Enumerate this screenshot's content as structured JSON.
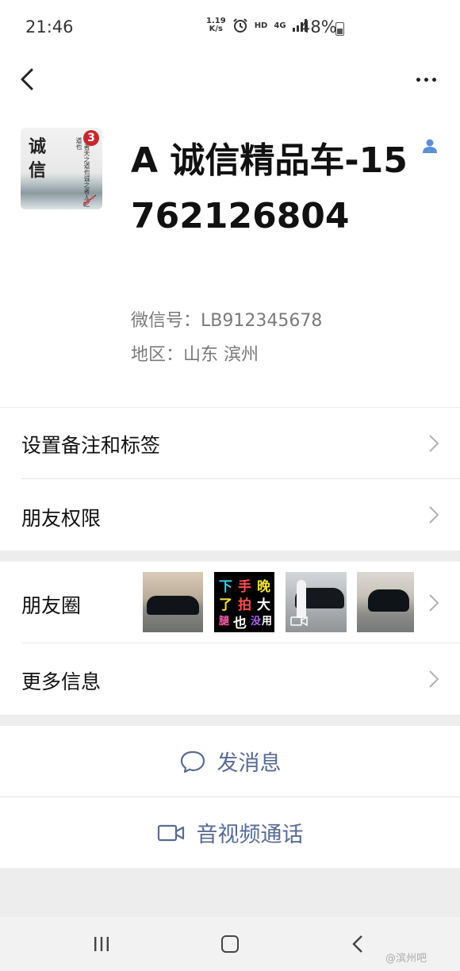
{
  "status_bar": {
    "time": "21:46",
    "net_speed_value": "1.19",
    "net_speed_unit": "K/s",
    "hd": "HD",
    "network": "4G",
    "battery": "48%"
  },
  "profile": {
    "avatar_chars": [
      "诚",
      "信"
    ],
    "avatar_badge": "3",
    "avatar_calligraphy": "诚者天之道也诚之者人之道也",
    "name": "A 诚信精品车-15762126804",
    "wechat_id": "微信号：LB912345678",
    "region": "地区：山东  滨州"
  },
  "menu": {
    "remark_tags": "设置备注和标签",
    "friend_permissions": "朋友权限",
    "moments": "朋友圈",
    "more_info": "更多信息"
  },
  "moments_thumb_text": {
    "line1": [
      "下",
      "手",
      "晚"
    ],
    "line2": [
      "了",
      "拍",
      "大"
    ],
    "line3": [
      "腿",
      "也",
      "没",
      "用"
    ]
  },
  "actions": {
    "send_message": "发消息",
    "video_call": "音视频通话"
  },
  "watermark": "@滨州吧",
  "colors": {
    "accent": "#576b95",
    "contact_icon": "#5b8fd8",
    "badge": "#c8282d"
  }
}
